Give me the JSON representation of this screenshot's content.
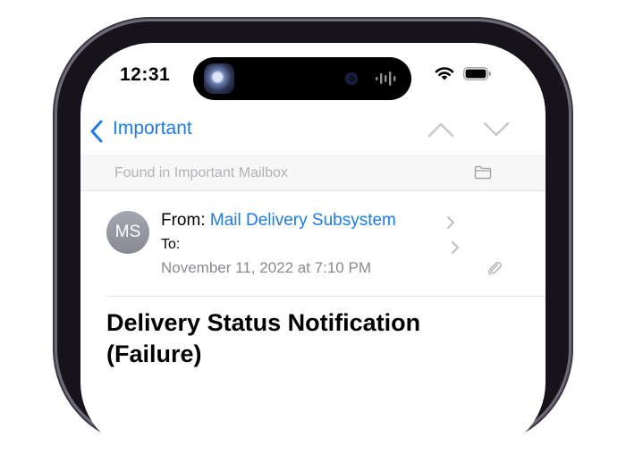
{
  "status_bar": {
    "time": "12:31"
  },
  "nav": {
    "back_label": "Important"
  },
  "found_bar": {
    "text": "Found in Important Mailbox"
  },
  "message": {
    "avatar_initials": "MS",
    "from_label": "From:",
    "from_name": "Mail Delivery Subsystem",
    "to_label": "To:",
    "date": "November 11, 2022 at 7:10 PM",
    "subject": "Delivery Status Notification (Failure)"
  },
  "icons": {
    "back": "chevron-left-icon",
    "previous": "chevron-up-icon",
    "next": "chevron-down-icon",
    "folder": "folder-icon",
    "attachment": "paperclip-icon",
    "wifi": "wifi-icon",
    "battery": "battery-icon"
  },
  "colors": {
    "accent": "#1e7be0",
    "secondary_text": "#8a8a8e"
  }
}
